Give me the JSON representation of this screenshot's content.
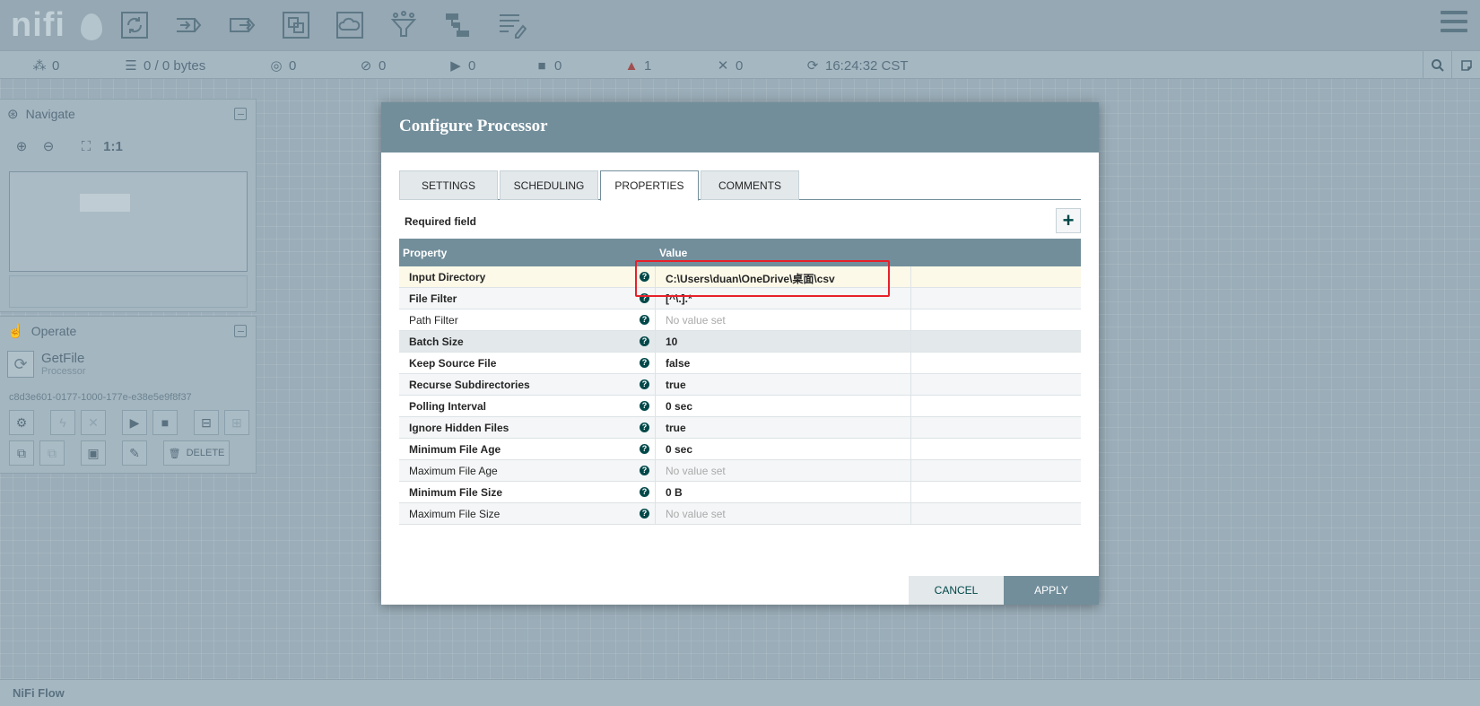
{
  "app": {
    "logo_text": "nifi",
    "flow_name": "NiFi Flow"
  },
  "toolbar": {
    "icons": [
      "processor-icon",
      "input-port-icon",
      "output-port-icon",
      "process-group-icon",
      "remote-process-group-icon",
      "funnel-icon",
      "template-icon",
      "label-icon"
    ]
  },
  "status": {
    "transmitting": "0",
    "queued": "0 / 0 bytes",
    "transmitting_rpg": "0",
    "not_transmitting_rpg": "0",
    "running": "0",
    "stopped": "0",
    "invalid": "1",
    "disabled": "0",
    "refreshed": "16:24:32 CST"
  },
  "navigate": {
    "title": "Navigate"
  },
  "operate": {
    "title": "Operate",
    "component_name": "GetFile",
    "component_type": "Processor",
    "component_id": "c8d3e601-0177-1000-177e-e38e5e9f8f37",
    "delete_label": "DELETE"
  },
  "dialog": {
    "title": "Configure Processor",
    "tabs": [
      "SETTINGS",
      "SCHEDULING",
      "PROPERTIES",
      "COMMENTS"
    ],
    "active_tab": "PROPERTIES",
    "required_label": "Required field",
    "add_label": "+",
    "columns": {
      "property": "Property",
      "value": "Value"
    },
    "rows": [
      {
        "name": "Input Directory",
        "value": "C:\\Users\\duan\\OneDrive\\桌面\\csv"
      },
      {
        "name": "File Filter",
        "value": "[^\\.].*"
      },
      {
        "name": "Path Filter",
        "value": "No value set"
      },
      {
        "name": "Batch Size",
        "value": "10"
      },
      {
        "name": "Keep Source File",
        "value": "false"
      },
      {
        "name": "Recurse Subdirectories",
        "value": "true"
      },
      {
        "name": "Polling Interval",
        "value": "0 sec"
      },
      {
        "name": "Ignore Hidden Files",
        "value": "true"
      },
      {
        "name": "Minimum File Age",
        "value": "0 sec"
      },
      {
        "name": "Maximum File Age",
        "value": "No value set"
      },
      {
        "name": "Minimum File Size",
        "value": "0 B"
      },
      {
        "name": "Maximum File Size",
        "value": "No value set"
      }
    ],
    "cancel_label": "CANCEL",
    "apply_label": "APPLY"
  },
  "colors": {
    "header_bar": "#728e9b",
    "accent": "#004849",
    "annotation": "#e8202a"
  }
}
